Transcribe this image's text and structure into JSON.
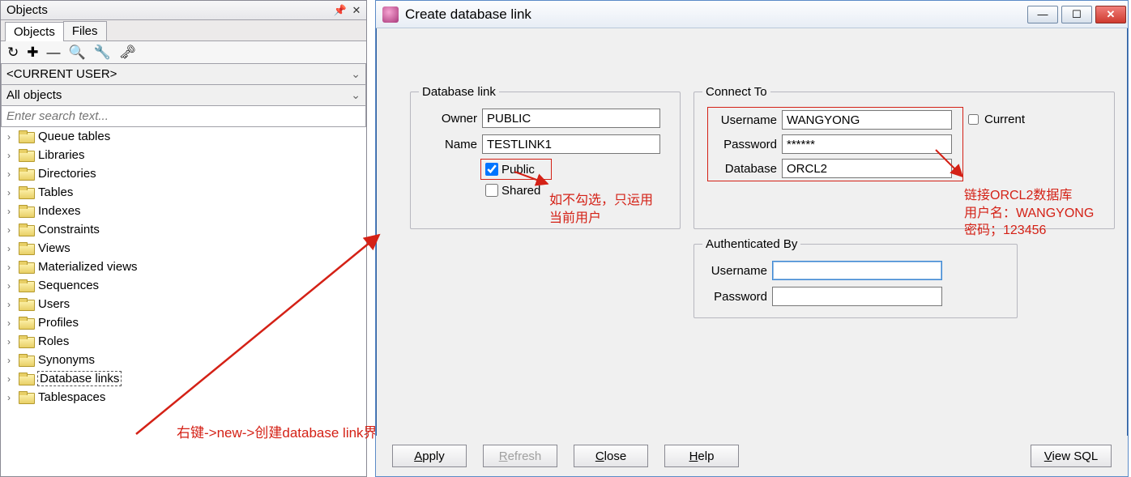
{
  "objects_panel": {
    "title": "Objects",
    "tabs": {
      "objects": "Objects",
      "files": "Files"
    },
    "scope_dropdown": "<CURRENT USER>",
    "filter_dropdown": "All objects",
    "search_placeholder": "Enter search text...",
    "tree_items": [
      "Queue tables",
      "Libraries",
      "Directories",
      "Tables",
      "Indexes",
      "Constraints",
      "Views",
      "Materialized views",
      "Sequences",
      "Users",
      "Profiles",
      "Roles",
      "Synonyms",
      "Database links",
      "Tablespaces"
    ],
    "highlighted_index": 13
  },
  "dialog": {
    "title": "Create database link",
    "dblink": {
      "legend": "Database link",
      "owner_label": "Owner",
      "owner_value": "PUBLIC",
      "name_label": "Name",
      "name_value": "TESTLINK1",
      "public_label": "Public",
      "public_checked": true,
      "shared_label": "Shared",
      "shared_checked": false
    },
    "connect": {
      "legend": "Connect To",
      "username_label": "Username",
      "username_value": "WANGYONG",
      "password_label": "Password",
      "password_value": "******",
      "database_label": "Database",
      "database_value": "ORCL2",
      "current_label": "Current",
      "current_checked": false
    },
    "auth": {
      "legend": "Authenticated By",
      "username_label": "Username",
      "username_value": "",
      "password_label": "Password",
      "password_value": ""
    },
    "buttons": {
      "apply": "Apply",
      "refresh": "Refresh",
      "close": "Close",
      "help": "Help",
      "view_sql": "View SQL"
    }
  },
  "annotations": {
    "tree_note": "右键->new->创建database link界面",
    "public_note_l1": "如不勾选，只运用",
    "public_note_l2": "当前用户",
    "connect_note_l1": "链接ORCL2数据库",
    "connect_note_l2": "用户名：WANGYONG",
    "connect_note_l3": "密码；123456"
  }
}
